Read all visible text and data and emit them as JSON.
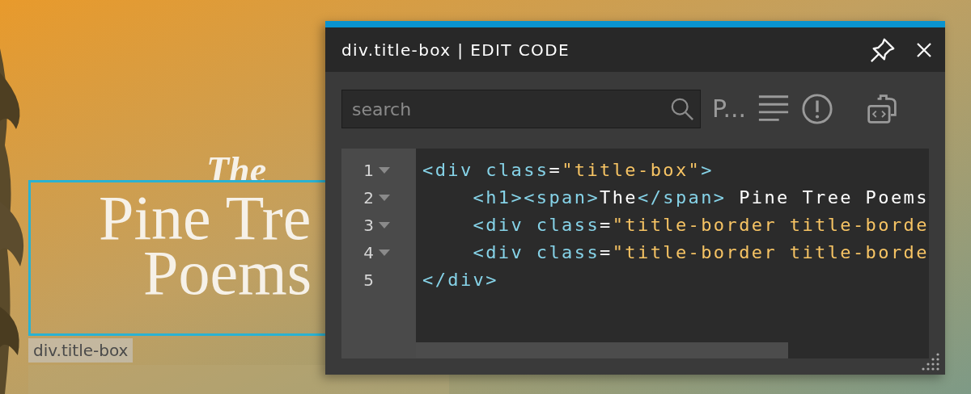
{
  "page": {
    "title_lines": [
      {
        "kind": "small",
        "text": "The"
      },
      {
        "kind": "large",
        "text": "Pine Tre"
      },
      {
        "kind": "large",
        "text": "Poems"
      }
    ],
    "selection_label": "div.title-box"
  },
  "panel": {
    "title": "div.title-box | EDIT CODE",
    "search": {
      "placeholder": "search"
    },
    "toolbar": [
      {
        "kind": "text",
        "label": "P..."
      },
      {
        "kind": "lines"
      },
      {
        "kind": "alert"
      },
      {
        "kind": "clipboard"
      }
    ],
    "code": [
      {
        "number": "1",
        "foldable": true,
        "tokens": [
          {
            "kind": "tag",
            "text": "<div"
          },
          {
            "kind": "attr",
            "text": " class"
          },
          {
            "kind": "plain",
            "text": "="
          },
          {
            "kind": "string",
            "text": "\"title-box\""
          },
          {
            "kind": "tag",
            "text": ">"
          }
        ]
      },
      {
        "number": "2",
        "foldable": true,
        "tokens": [
          {
            "kind": "tag",
            "text": "    <h1><span>"
          },
          {
            "kind": "plain",
            "text": "The"
          },
          {
            "kind": "tag",
            "text": "</span>"
          },
          {
            "kind": "plain",
            "text": " Pine Tree Poems"
          }
        ]
      },
      {
        "number": "3",
        "foldable": true,
        "tokens": [
          {
            "kind": "tag",
            "text": "    <div"
          },
          {
            "kind": "attr",
            "text": " class"
          },
          {
            "kind": "plain",
            "text": "="
          },
          {
            "kind": "string",
            "text": "\"title-border title-borde"
          }
        ]
      },
      {
        "number": "4",
        "foldable": true,
        "tokens": [
          {
            "kind": "tag",
            "text": "    <div"
          },
          {
            "kind": "attr",
            "text": " class"
          },
          {
            "kind": "plain",
            "text": "="
          },
          {
            "kind": "string",
            "text": "\"title-border title-borde"
          }
        ]
      },
      {
        "number": "5",
        "foldable": false,
        "tokens": [
          {
            "kind": "tag",
            "text": "</div>"
          }
        ]
      }
    ]
  }
}
